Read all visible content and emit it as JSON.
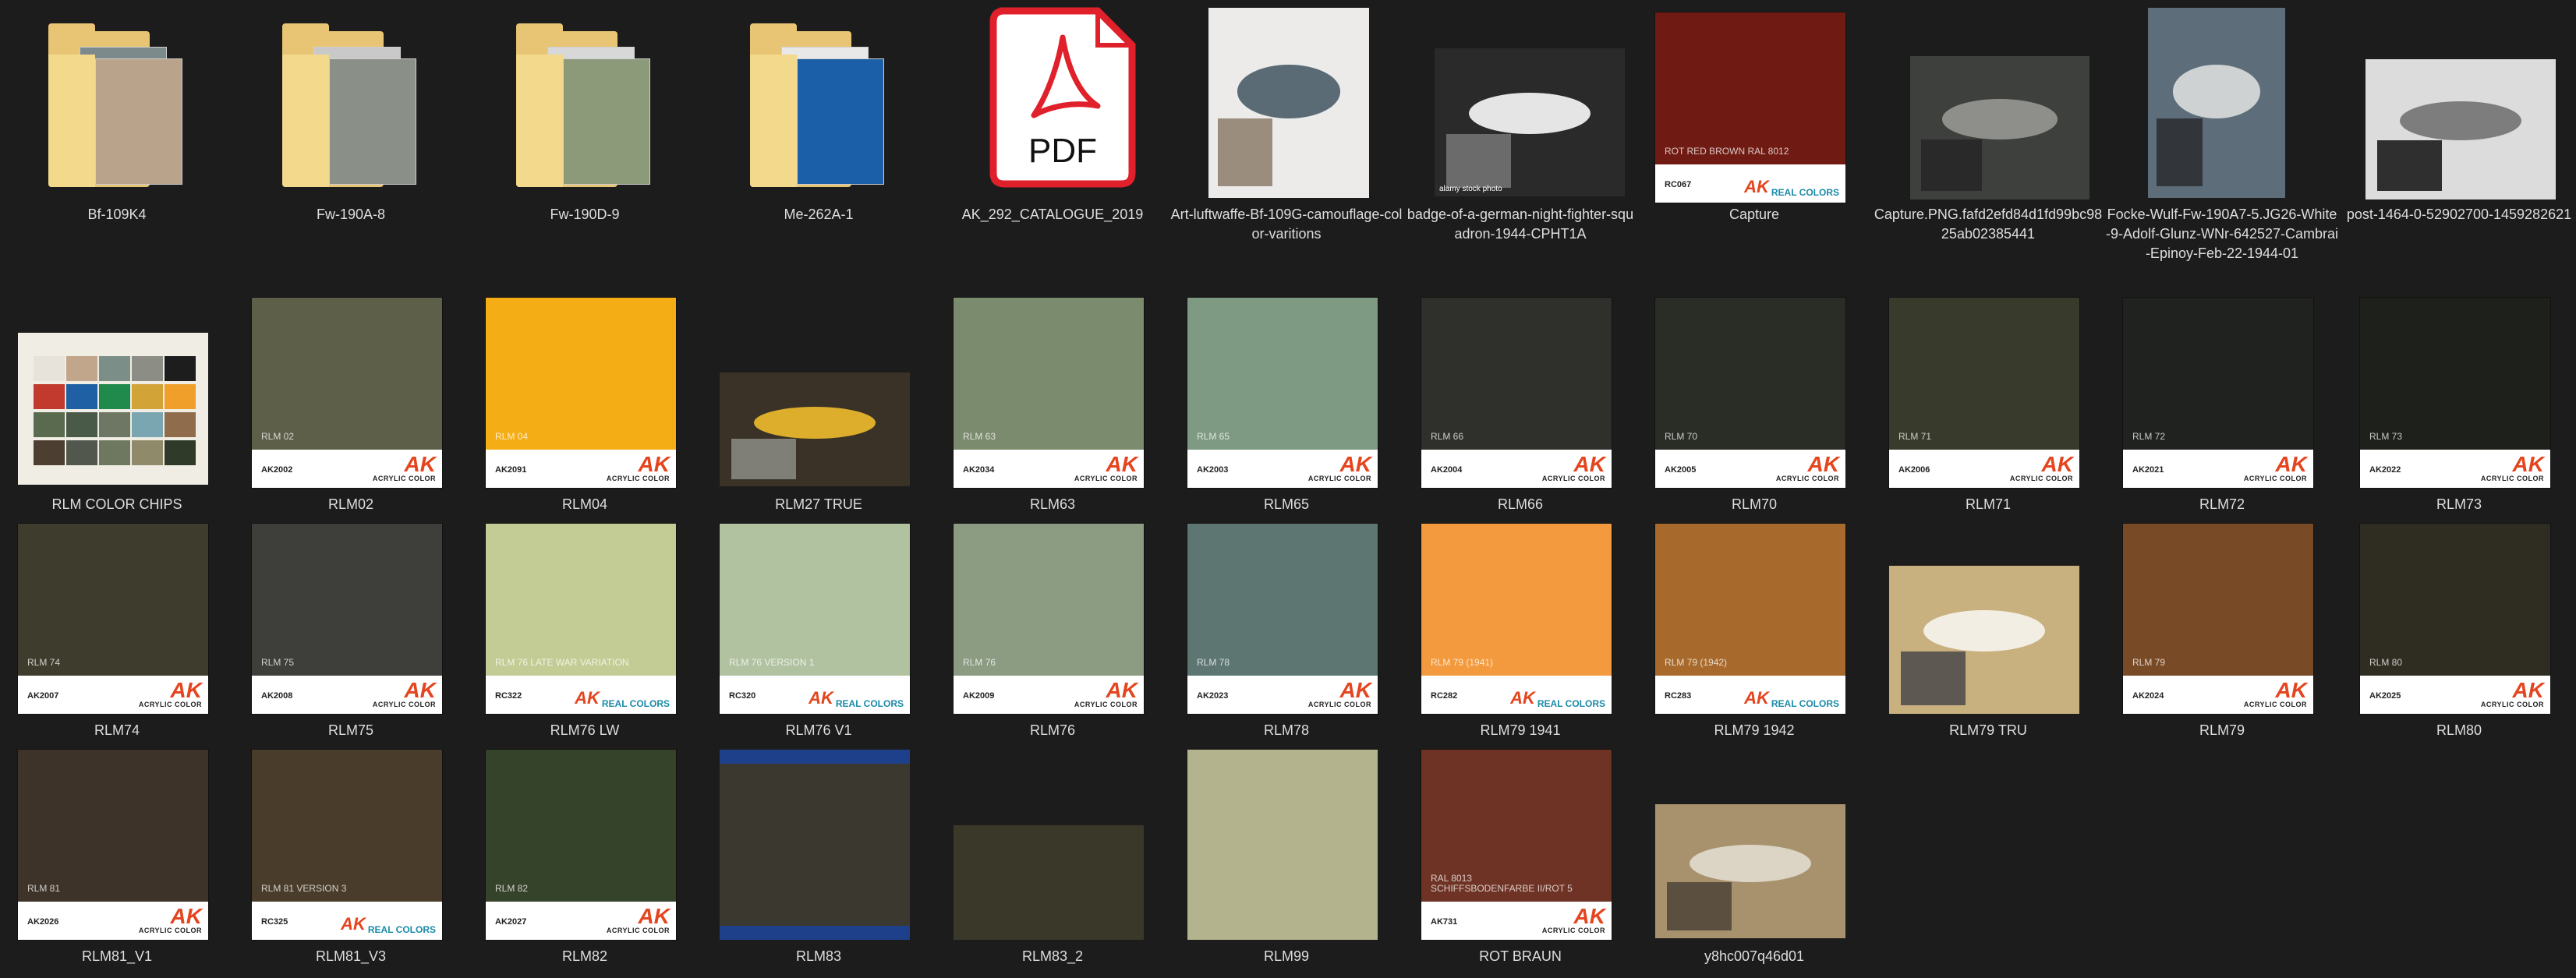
{
  "items": [
    {
      "label": "Bf-109K4",
      "kind": "folder",
      "art": {
        "front": "#b9a38a",
        "back": "#7d8a8c"
      }
    },
    {
      "label": "Fw-190A-8",
      "kind": "folder",
      "art": {
        "front": "#8a8f88",
        "back": "#c9c9c9"
      }
    },
    {
      "label": "Fw-190D-9",
      "kind": "folder",
      "art": {
        "front": "#8c9a7a",
        "back": "#d8d8d8"
      }
    },
    {
      "label": "Me-262A-1",
      "kind": "folder",
      "art": {
        "front": "#1a5fa8",
        "back": "#e8e8e8"
      }
    },
    {
      "label": "AK_292_CATALOGUE_2019",
      "kind": "pdf",
      "pdf_text": "PDF",
      "colors": {
        "border": "#e0202a",
        "body": "#ffffff"
      }
    },
    {
      "label": "Art-luftwaffe-Bf-109G-camouflage-color-varitions",
      "kind": "photo",
      "art": {
        "bg": "#ecebea",
        "accent": "#5a6b76",
        "accent2": "#8d7d6a"
      }
    },
    {
      "label": "badge-of-a-german-night-fighter-squadron-1944-CPHT1A",
      "kind": "photo",
      "photo_text": "alamy stock photo",
      "art": {
        "bg": "#2a2a2a",
        "accent": "#e5e5e5",
        "accent2": "#777777"
      }
    },
    {
      "label": "Capture",
      "kind": "swatch",
      "color": "#6f1b13",
      "swatch_text": "ROT RED BROWN RAL 8012",
      "code": "RC067",
      "brand": "AK",
      "brand_sub": "REAL COLORS",
      "real": true
    },
    {
      "label": "Capture.PNG.fafd2efd84d1fd99bc9825ab02385441",
      "kind": "photo",
      "art": {
        "bg": "#3e403d",
        "accent": "#8e8f8a",
        "accent2": "#262626"
      }
    },
    {
      "label": "Focke-Wulf-Fw-190A7-5.JG26-White-9-Adolf-Glunz-WNr-642527-Cambrai-Epinoy-Feb-22-1944-01",
      "kind": "photo",
      "art": {
        "bg": "#5d6d7a",
        "accent": "#cfd2d3",
        "accent2": "#2a2d30"
      }
    },
    {
      "label": "post-1464-0-52902700-1459282621",
      "kind": "photo",
      "art": {
        "bg": "#dcdcdc",
        "accent": "#7d7d7d",
        "accent2": "#111111"
      }
    },
    {
      "label": "RLM COLOR CHIPS",
      "kind": "chips",
      "art": {
        "bg": "#f0ede4",
        "chips": [
          "#e7e3da",
          "#c2a68c",
          "#7c8e88",
          "#8c8e86",
          "#1d1d1d",
          "#c23a2d",
          "#1f5fa3",
          "#1f8a4c",
          "#d2a438",
          "#f0a02a",
          "#5a6a4f",
          "#4a5a48",
          "#6d7763",
          "#7aa6b2",
          "#8e6c4c",
          "#4c3f32",
          "#52574e",
          "#6e7760",
          "#8f8a6a",
          "#2f3a28"
        ]
      }
    },
    {
      "label": "RLM02",
      "kind": "swatch",
      "color": "#5d5f48",
      "swatch_text": "RLM 02",
      "code": "AK2002",
      "brand": "AK",
      "brand_sub": "ACRYLIC COLOR",
      "real": false
    },
    {
      "label": "RLM04",
      "kind": "swatch",
      "color": "#f5ad16",
      "swatch_text": "RLM 04",
      "code": "AK2091",
      "brand": "AK",
      "brand_sub": "ACRYLIC COLOR",
      "real": false
    },
    {
      "label": "RLM27 TRUE",
      "kind": "photo",
      "art": {
        "bg": "#3a3226",
        "accent": "#dcae2c",
        "accent2": "#8c8c86"
      }
    },
    {
      "label": "RLM63",
      "kind": "swatch",
      "color": "#7b8b6d",
      "swatch_text": "RLM 63",
      "code": "AK2034",
      "brand": "AK",
      "brand_sub": "ACRYLIC COLOR",
      "real": false
    },
    {
      "label": "RLM65",
      "kind": "swatch",
      "color": "#7e9a82",
      "swatch_text": "RLM 65",
      "code": "AK2003",
      "brand": "AK",
      "brand_sub": "ACRYLIC COLOR",
      "real": false
    },
    {
      "label": "RLM66",
      "kind": "swatch",
      "color": "#2f302b",
      "swatch_text": "RLM 66",
      "code": "AK2004",
      "brand": "AK",
      "brand_sub": "ACRYLIC COLOR",
      "real": false
    },
    {
      "label": "RLM70",
      "kind": "swatch",
      "color": "#2a2c26",
      "swatch_text": "RLM 70",
      "code": "AK2005",
      "brand": "AK",
      "brand_sub": "ACRYLIC COLOR",
      "real": false
    },
    {
      "label": "RLM71",
      "kind": "swatch",
      "color": "#383a2b",
      "swatch_text": "RLM 71",
      "code": "AK2006",
      "brand": "AK",
      "brand_sub": "ACRYLIC COLOR",
      "real": false
    },
    {
      "label": "RLM72",
      "kind": "swatch",
      "color": "#20221f",
      "swatch_text": "RLM 72",
      "code": "AK2021",
      "brand": "AK",
      "brand_sub": "ACRYLIC COLOR",
      "real": false
    },
    {
      "label": "RLM73",
      "kind": "swatch",
      "color": "#1e211b",
      "swatch_text": "RLM 73",
      "code": "AK2022",
      "brand": "AK",
      "brand_sub": "ACRYLIC COLOR",
      "real": false
    },
    {
      "label": "RLM74",
      "kind": "swatch",
      "color": "#3e3c2c",
      "swatch_text": "RLM 74",
      "code": "AK2007",
      "brand": "AK",
      "brand_sub": "ACRYLIC COLOR",
      "real": false
    },
    {
      "label": "RLM75",
      "kind": "swatch",
      "color": "#3e3e3a",
      "swatch_text": "RLM 75",
      "code": "AK2008",
      "brand": "AK",
      "brand_sub": "ACRYLIC COLOR",
      "real": false
    },
    {
      "label": "RLM76 LW",
      "kind": "swatch",
      "color": "#c3cc95",
      "swatch_text": "RLM 76 LATE WAR VARIATION",
      "code": "RC322",
      "brand": "AK",
      "brand_sub": "REAL COLORS",
      "real": true
    },
    {
      "label": "RLM76 V1",
      "kind": "swatch",
      "color": "#b1c2a0",
      "swatch_text": "RLM 76 VERSION 1",
      "code": "RC320",
      "brand": "AK",
      "brand_sub": "REAL COLORS",
      "real": true
    },
    {
      "label": "RLM76",
      "kind": "swatch",
      "color": "#8b9c83",
      "swatch_text": "RLM 76",
      "code": "AK2009",
      "brand": "AK",
      "brand_sub": "ACRYLIC COLOR",
      "real": false
    },
    {
      "label": "RLM78",
      "kind": "swatch",
      "color": "#5e7672",
      "swatch_text": "RLM 78",
      "code": "AK2023",
      "brand": "AK",
      "brand_sub": "ACRYLIC COLOR",
      "real": false
    },
    {
      "label": "RLM79 1941",
      "kind": "swatch",
      "color": "#f29a3d",
      "swatch_text": "RLM 79 (1941)",
      "code": "RC282",
      "brand": "AK",
      "brand_sub": "REAL COLORS",
      "real": true
    },
    {
      "label": "RLM79 1942",
      "kind": "swatch",
      "color": "#a86a2c",
      "swatch_text": "RLM 79 (1942)",
      "code": "RC283",
      "brand": "AK",
      "brand_sub": "REAL COLORS",
      "real": true
    },
    {
      "label": "RLM79 TRU",
      "kind": "photo",
      "art": {
        "bg": "#c8b07f",
        "accent": "#f3eee4",
        "accent2": "#4a4a4a"
      }
    },
    {
      "label": "RLM79",
      "kind": "swatch",
      "color": "#794a26",
      "swatch_text": "RLM 79",
      "code": "AK2024",
      "brand": "AK",
      "brand_sub": "ACRYLIC COLOR",
      "real": false
    },
    {
      "label": "RLM80",
      "kind": "swatch",
      "color": "#2f2c21",
      "swatch_text": "RLM 80",
      "code": "AK2025",
      "brand": "AK",
      "brand_sub": "ACRYLIC COLOR",
      "real": false
    },
    {
      "label": "RLM81_V1",
      "kind": "swatch",
      "color": "#3d3328",
      "swatch_text": "RLM 81",
      "code": "AK2026",
      "brand": "AK",
      "brand_sub": "ACRYLIC COLOR",
      "real": false
    },
    {
      "label": "RLM81_V3",
      "kind": "swatch",
      "color": "#4a3c2a",
      "swatch_text": "RLM 81 VERSION 3",
      "code": "RC325",
      "brand": "AK",
      "brand_sub": "REAL COLORS",
      "real": true
    },
    {
      "label": "RLM82",
      "kind": "swatch",
      "color": "#36432b",
      "swatch_text": "RLM 82",
      "code": "AK2027",
      "brand": "AK",
      "brand_sub": "ACRYLIC COLOR",
      "real": false
    },
    {
      "label": "RLM83",
      "kind": "plain",
      "color": "#3b392f",
      "band": "#1e3f8a"
    },
    {
      "label": "RLM83_2",
      "kind": "plain",
      "color": "#3a3828"
    },
    {
      "label": "RLM99",
      "kind": "plain",
      "color": "#b3b48d"
    },
    {
      "label": "ROT BRAUN",
      "kind": "swatch",
      "color": "#6e3324",
      "swatch_text": "RAL 8013\nSCHIFFSBODENFARBE II/ROT 5",
      "code": "AK731",
      "brand": "AK",
      "brand_sub": "ACRYLIC COLOR",
      "real": false
    },
    {
      "label": "y8hc007q46d01",
      "kind": "photo",
      "art": {
        "bg": "#a8926e",
        "accent": "#dcd4c4",
        "accent2": "#4d4438"
      }
    }
  ]
}
